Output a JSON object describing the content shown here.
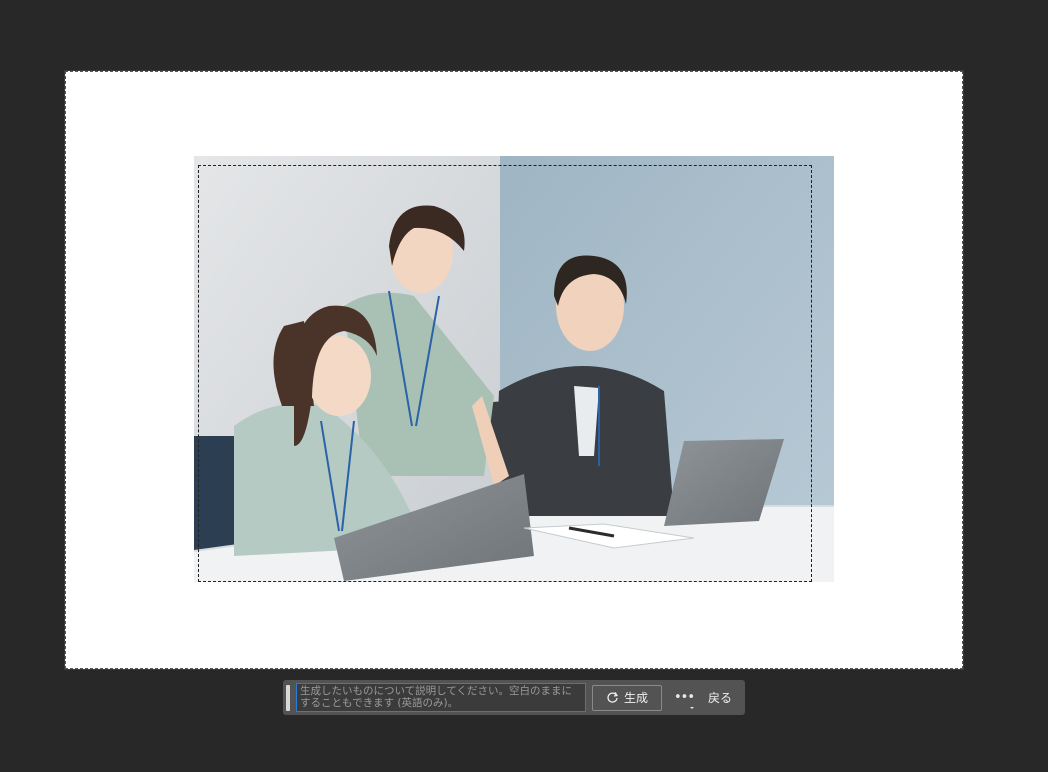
{
  "taskbar": {
    "prompt_placeholder": "生成したいものについて説明してください。空白のままにすることもできます (英語のみ)。",
    "generate_label": "生成",
    "more_label": "•••",
    "back_label": "戻る"
  },
  "icons": {
    "generate": "generate-icon",
    "more": "more-options-icon",
    "grip": "drag-handle-icon"
  },
  "colors": {
    "workspace": "#282828",
    "document": "#ffffff",
    "taskbar": "#535353",
    "input_focus": "#2d7bd6"
  }
}
